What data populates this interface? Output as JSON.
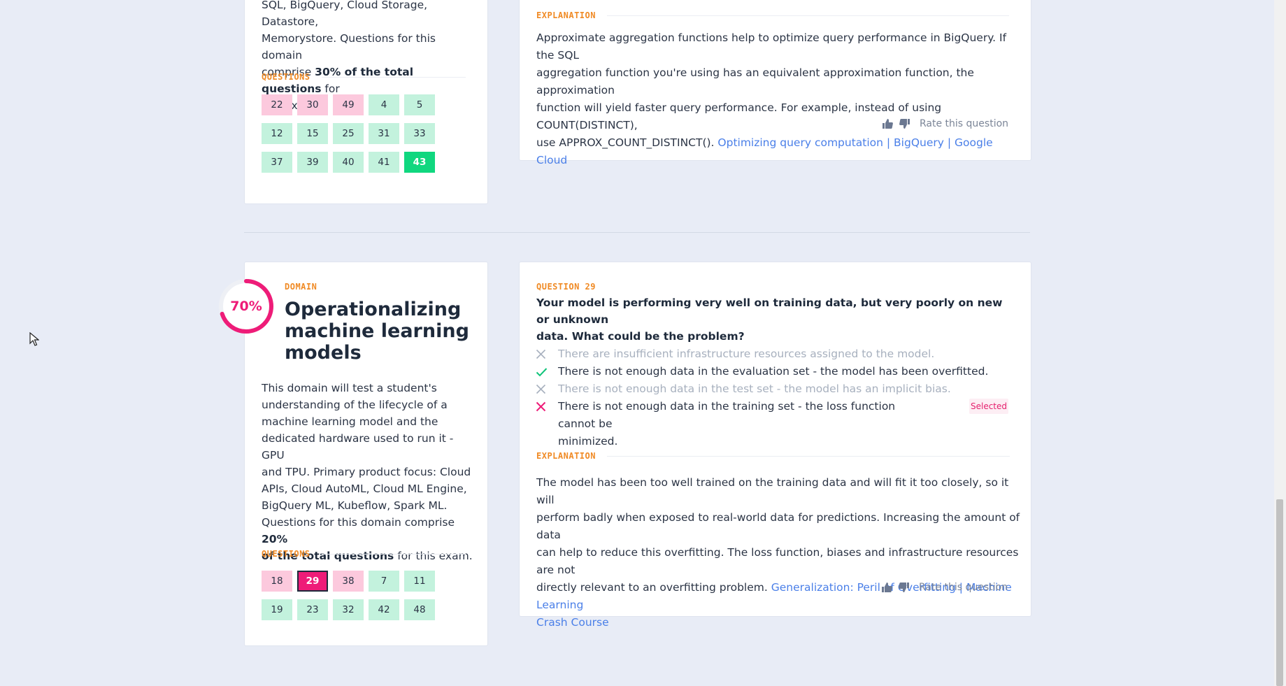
{
  "domain1": {
    "desc_lines": [
      "SQL, BigQuery, Cloud Storage, Datastore,",
      "Memorystore. Questions for this domain"
    ],
    "desc_pre": "comprise ",
    "desc_bold": "30% of the total questions",
    "desc_post": " for",
    "desc_last": "this exam.",
    "questions_label": "QUESTIONS",
    "questions": [
      {
        "n": "22",
        "status": "wrong"
      },
      {
        "n": "30",
        "status": "wrong"
      },
      {
        "n": "49",
        "status": "wrong"
      },
      {
        "n": "4",
        "status": "right"
      },
      {
        "n": "5",
        "status": "right"
      },
      {
        "n": "12",
        "status": "right"
      },
      {
        "n": "15",
        "status": "right"
      },
      {
        "n": "25",
        "status": "right"
      },
      {
        "n": "31",
        "status": "right"
      },
      {
        "n": "33",
        "status": "right"
      },
      {
        "n": "37",
        "status": "right"
      },
      {
        "n": "39",
        "status": "right"
      },
      {
        "n": "40",
        "status": "right"
      },
      {
        "n": "41",
        "status": "right"
      },
      {
        "n": "43",
        "status": "current-right"
      }
    ]
  },
  "question_prev": {
    "explanation_label": "EXPLANATION",
    "explanation_lines": [
      "Approximate aggregation functions help to optimize query performance in BigQuery. If the SQL",
      "aggregation function you're using has an equivalent approximation function, the approximation",
      "function will yield faster query performance. For example, instead of using COUNT(DISTINCT),"
    ],
    "explanation_last": "use APPROX_COUNT_DISTINCT(). ",
    "link": "Optimizing query computation | BigQuery | Google Cloud",
    "rate_label": "Rate this question"
  },
  "domain2": {
    "percent": "70%",
    "percent_value": 70,
    "domain_label": "DOMAIN",
    "title_lines": [
      "Operationalizing",
      "machine learning",
      "models"
    ],
    "desc_lines": [
      "This domain will test a student's",
      "understanding of the lifecycle of a",
      "machine learning model and the",
      "dedicated hardware used to run it - GPU",
      "and TPU. Primary product focus: Cloud",
      "APIs, Cloud AutoML, Cloud ML Engine,",
      "BigQuery ML, Kubeflow, Spark ML."
    ],
    "desc_pre": "Questions for this domain comprise ",
    "desc_bold1": "20%",
    "desc_bold2": "of the total questions",
    "desc_post": " for this exam.",
    "questions_label": "QUESTIONS",
    "questions": [
      {
        "n": "18",
        "status": "wrong"
      },
      {
        "n": "29",
        "status": "current-wrong"
      },
      {
        "n": "38",
        "status": "wrong"
      },
      {
        "n": "7",
        "status": "right"
      },
      {
        "n": "11",
        "status": "right"
      },
      {
        "n": "19",
        "status": "right"
      },
      {
        "n": "23",
        "status": "right"
      },
      {
        "n": "32",
        "status": "right"
      },
      {
        "n": "42",
        "status": "right"
      },
      {
        "n": "48",
        "status": "right"
      }
    ]
  },
  "question29": {
    "label": "QUESTION 29",
    "text_lines": [
      "Your model is performing very well on training data, but very poorly on new or unknown",
      "data. What could be the problem?"
    ],
    "answers": [
      {
        "text": "There are insufficient infrastructure resources assigned to the model.",
        "state": "dim"
      },
      {
        "text": "There is not enough data in the evaluation set - the model has been overfitted.",
        "state": "correct"
      },
      {
        "text": "There is not enough data in the test set - the model has an implicit bias.",
        "state": "dim"
      },
      {
        "text": "There is not enough data in the training set - the loss function cannot be",
        "text2": "minimized.",
        "state": "selected-wrong"
      }
    ],
    "selected_badge": "Selected",
    "explanation_label": "EXPLANATION",
    "explanation_lines": [
      "The model has been too well trained on the training data and will fit it too closely, so it will",
      "perform badly when exposed to real-world data for predictions. Increasing the amount of data",
      "can help to reduce this overfitting. The loss function, biases and infrastructure resources are not"
    ],
    "explanation_last": "directly relevant to an overfitting problem. ",
    "link_part1": "Generalization: Peril of Overfitting | Machine Learning",
    "link_part2": "Crash Course",
    "rate_label": "Rate this question"
  },
  "colors": {
    "accent_orange": "#f08a24",
    "wrong_pink": "#fcc9dd",
    "right_green": "#c3f2dd",
    "current_green": "#10d77f",
    "current_pink": "#ee1c78",
    "link_blue": "#4a7fe8"
  }
}
